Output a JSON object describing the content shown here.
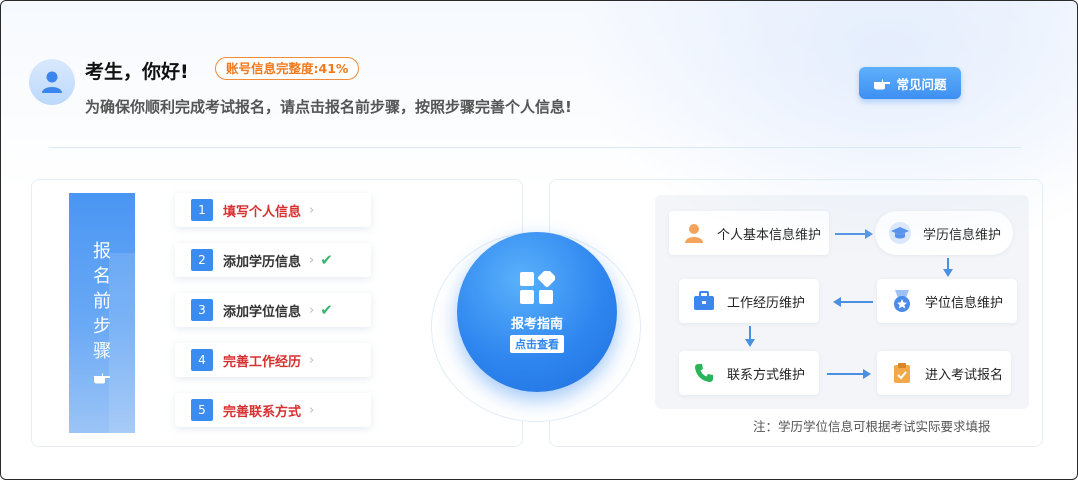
{
  "header": {
    "greeting": "考生，你好!",
    "progress_label": "账号信息完整度:41%",
    "progress_value": 41,
    "subtitle": "为确保你顺利完成考试报名，请点击报名前步骤，按照步骤完善个人信息!",
    "faq_label": "常见问题"
  },
  "banner": {
    "chars": [
      "报",
      "名",
      "前",
      "步",
      "骤"
    ]
  },
  "steps": [
    {
      "num": "1",
      "label": "填写个人信息",
      "status": "incomplete"
    },
    {
      "num": "2",
      "label": "添加学历信息",
      "status": "complete"
    },
    {
      "num": "3",
      "label": "添加学位信息",
      "status": "complete"
    },
    {
      "num": "4",
      "label": "完善工作经历",
      "status": "incomplete"
    },
    {
      "num": "5",
      "label": "完善联系方式",
      "status": "incomplete"
    }
  ],
  "guide": {
    "title": "报考指南",
    "button": "点击查看"
  },
  "flow": {
    "nodes": {
      "personal": "个人基本信息维护",
      "education": "学历信息维护",
      "work": "工作经历维护",
      "degree": "学位信息维护",
      "contact": "联系方式维护",
      "enter": "进入考试报名"
    },
    "note": "注：学历学位信息可根据考试实际要求填报"
  },
  "colors": {
    "accent": "#3b8cf0",
    "warning": "#f07a20",
    "incomplete": "#d8302f",
    "complete": "#3cb371"
  },
  "icons": {
    "avatar": "user-icon",
    "faq": "pointing-hand-icon",
    "guide": "grid-diamond-icon"
  }
}
